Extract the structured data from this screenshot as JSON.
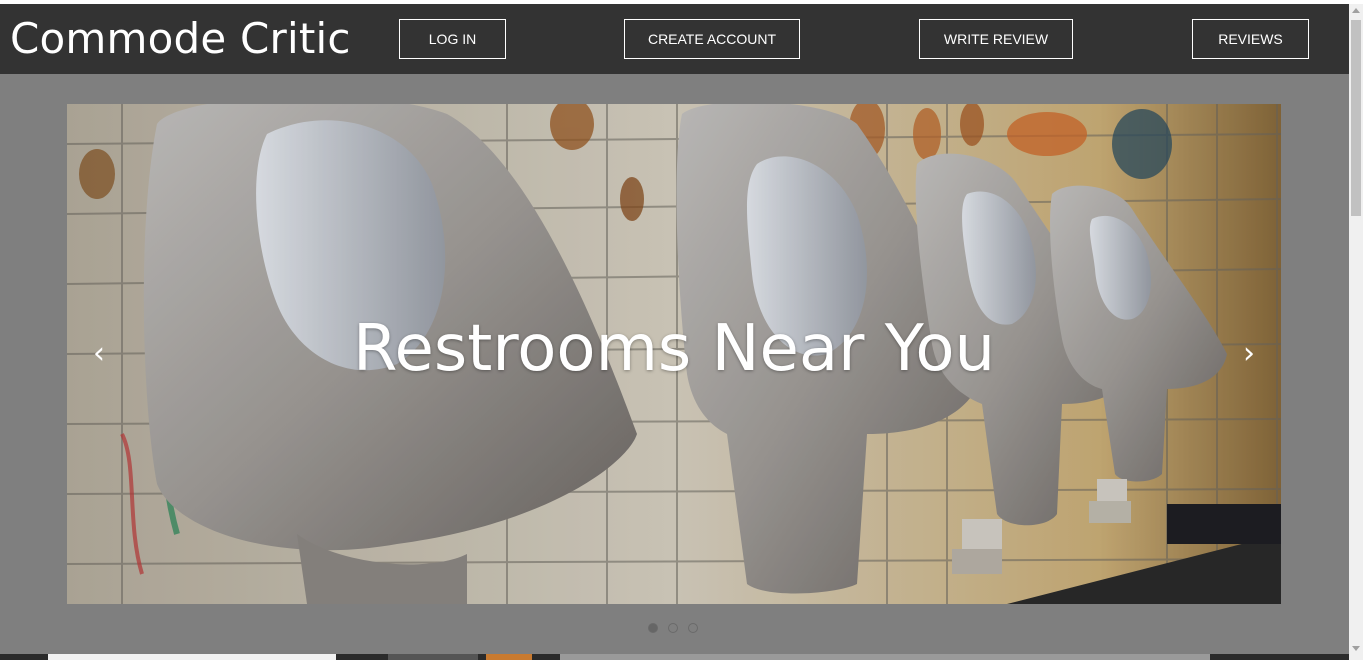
{
  "brand": {
    "title": "Commode Critic"
  },
  "nav": {
    "login": "LOG IN",
    "create_account": "CREATE ACCOUNT",
    "write_review": "WRITE REVIEW",
    "reviews": "REVIEWS"
  },
  "hero": {
    "caption": "Restrooms Near You",
    "prev_icon": "chevron-left-icon",
    "next_icon": "chevron-right-icon",
    "slides_count": 3,
    "active_slide": 1
  },
  "colors": {
    "navbar": "#333333",
    "background": "#7f7f7f",
    "text": "#ffffff"
  }
}
